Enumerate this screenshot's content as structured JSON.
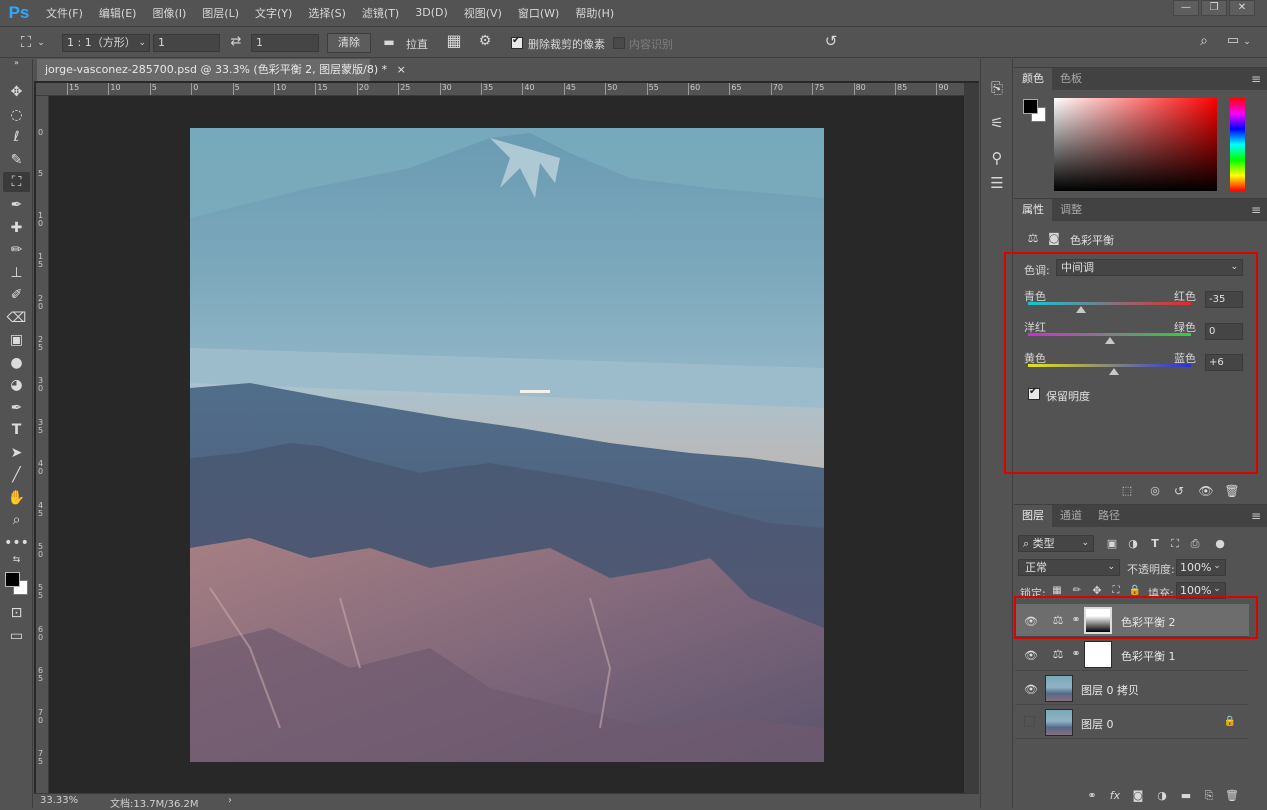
{
  "app": {
    "logo": "Ps"
  },
  "menu": [
    "文件(F)",
    "编辑(E)",
    "图像(I)",
    "图层(L)",
    "文字(Y)",
    "选择(S)",
    "滤镜(T)",
    "3D(D)",
    "视图(V)",
    "窗口(W)",
    "帮助(H)"
  ],
  "window_buttons": [
    "—",
    "❐",
    "✕"
  ],
  "options": {
    "ratio": "1 : 1（方形）",
    "width_value": "1",
    "height_value": "1",
    "clear_label": "清除",
    "straighten_label": "拉直",
    "delete_cropped_label": "删除裁剪的像素",
    "content_aware_label": "内容识别"
  },
  "document": {
    "tab_title": "jorge-vasconez-285700.psd @ 33.3% (色彩平衡 2, 图层蒙版/8) *",
    "close_glyph": "×",
    "ruler_h": [
      "15",
      "10",
      "5",
      "0",
      "5",
      "10",
      "15",
      "20",
      "25",
      "30",
      "35",
      "40",
      "45",
      "50",
      "55",
      "60",
      "65",
      "70",
      "75",
      "80",
      "85",
      "90"
    ],
    "ruler_v": [
      "0",
      "5",
      "1\n0",
      "1\n5",
      "2\n0",
      "2\n5",
      "3\n0",
      "3\n5",
      "4\n0",
      "4\n5",
      "5\n0",
      "5\n5",
      "6\n0",
      "6\n5",
      "7\n0",
      "7\n5"
    ],
    "zoom": "33.33%",
    "doc_info": "文档:13.7M/36.2M",
    "status_arrow": "›"
  },
  "color_panel": {
    "tabs": [
      "颜色",
      "色板"
    ],
    "fg_color": "#000000",
    "bg_color": "#ffffff",
    "hue_color": "#ff0000"
  },
  "properties_panel": {
    "tabs": [
      "属性",
      "调整"
    ],
    "title": "色彩平衡",
    "tone_label": "色调:",
    "tone_value": "中间调",
    "sliders": [
      {
        "left": "青色",
        "right": "红色",
        "value": "-35",
        "level": -35
      },
      {
        "left": "洋红",
        "right": "绿色",
        "value": "0",
        "level": 0
      },
      {
        "left": "黄色",
        "right": "蓝色",
        "value": "+6",
        "level": 6
      }
    ],
    "preserve_luminosity_label": "保留明度",
    "preserve_luminosity": true
  },
  "layers_panel": {
    "tabs": [
      "图层",
      "通道",
      "路径"
    ],
    "filter_label": "类型",
    "blend_mode": "正常",
    "opacity_label": "不透明度:",
    "opacity_value": "100%",
    "lock_label": "锁定:",
    "fill_label": "填充:",
    "fill_value": "100%",
    "layers": [
      {
        "name": "色彩平衡 2",
        "type": "adjustment",
        "visible": true,
        "selected": true
      },
      {
        "name": "色彩平衡 1",
        "type": "adjustment",
        "visible": true,
        "selected": false
      },
      {
        "name": "图层 0 拷贝",
        "type": "pixel",
        "visible": true,
        "selected": false
      },
      {
        "name": "图层 0",
        "type": "pixel",
        "visible": false,
        "selected": false,
        "locked": true
      }
    ]
  },
  "colors": {
    "accent_blue": "#31a8ff",
    "highlight_red": "#e10000"
  }
}
